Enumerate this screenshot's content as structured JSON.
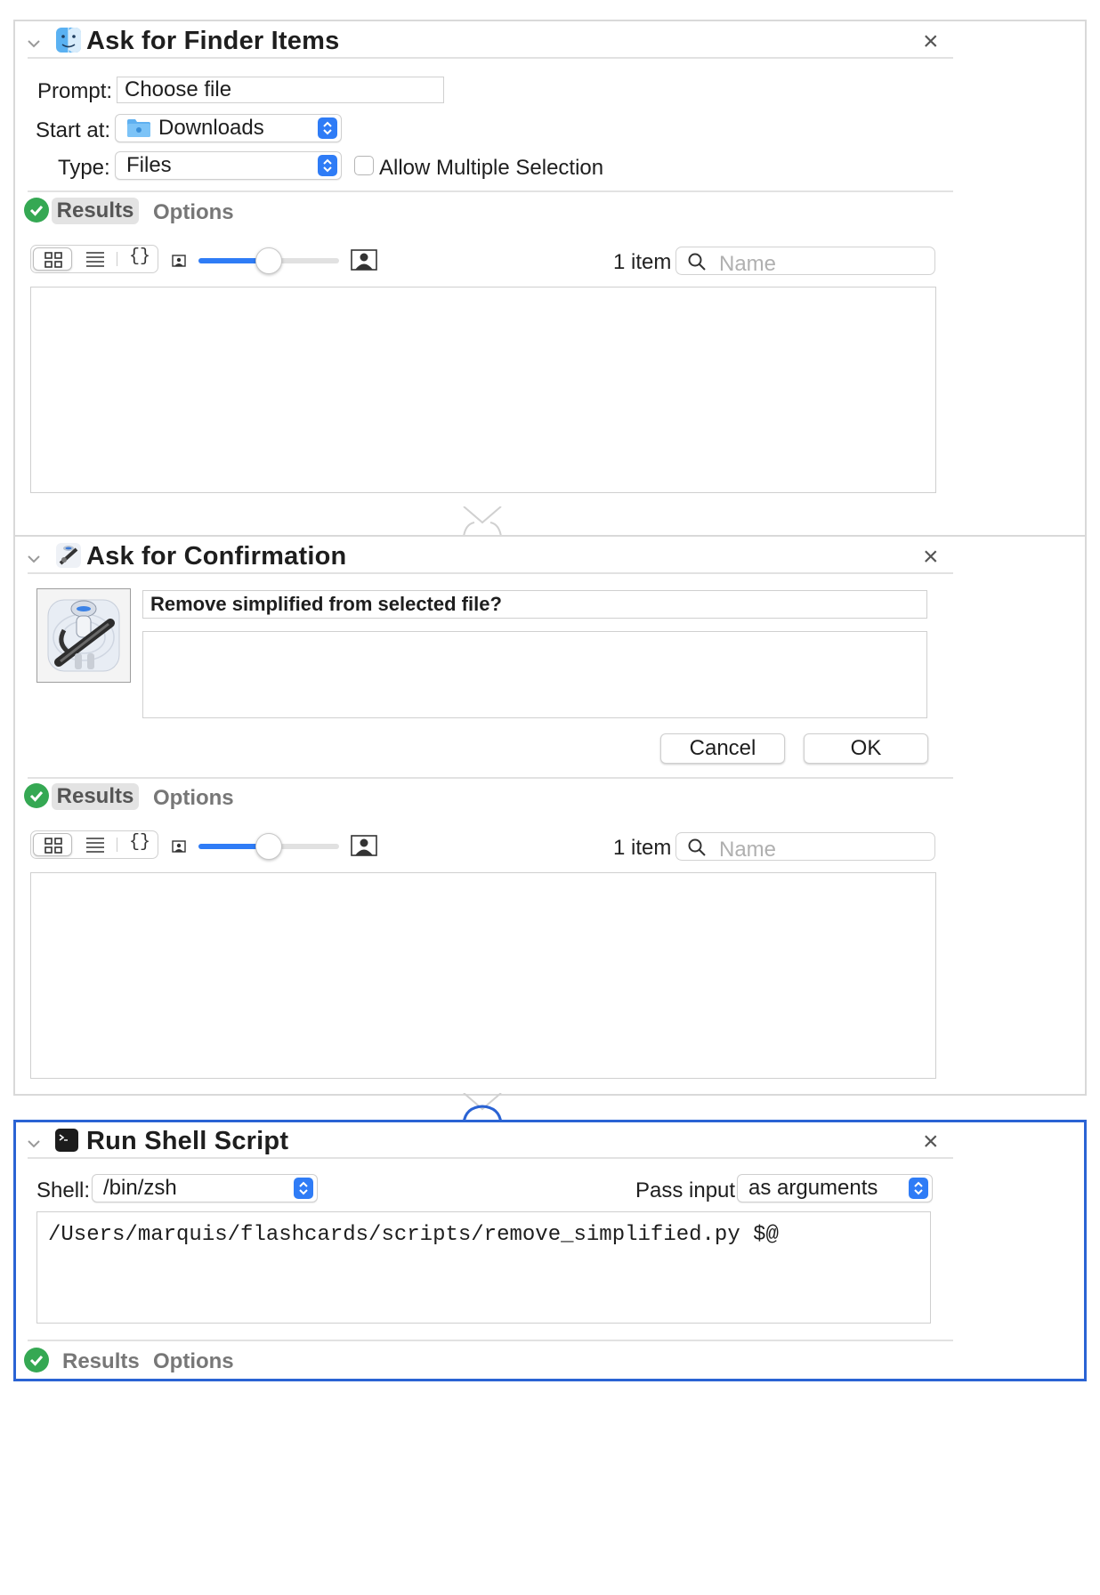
{
  "actions": [
    {
      "title": "Ask for Finder Items",
      "prompt_label": "Prompt:",
      "prompt_value": "Choose file",
      "start_at_label": "Start at:",
      "start_at_value": "Downloads",
      "type_label": "Type:",
      "type_value": "Files",
      "allow_multiple_label": "Allow Multiple Selection",
      "allow_multiple_checked": false,
      "results_tab": "Results",
      "options_tab": "Options",
      "count": "1 item",
      "search_placeholder": "Name"
    },
    {
      "title": "Ask for Confirmation",
      "question": "Remove simplified from selected file?",
      "message": "",
      "cancel_label": "Cancel",
      "ok_label": "OK",
      "results_tab": "Results",
      "options_tab": "Options",
      "count": "1 item",
      "search_placeholder": "Name"
    },
    {
      "title": "Run Shell Script",
      "shell_label": "Shell:",
      "shell_value": "/bin/zsh",
      "pass_input_label": "Pass input:",
      "pass_input_value": "as arguments",
      "script": "/Users/marquis/flashcards/scripts/remove_simplified.py $@",
      "results_tab": "Results",
      "options_tab": "Options"
    }
  ],
  "icons": {
    "view_icons": "grid-icon",
    "view_list": "list-icon",
    "view_json": "braces-icon",
    "small_size": "small-thumbnail-icon",
    "large_size": "large-thumbnail-icon",
    "search": "search-icon",
    "close": "close-icon"
  },
  "colors": {
    "accent": "#2f7cf6",
    "selected_border": "#2a63d4",
    "success": "#35a853"
  }
}
